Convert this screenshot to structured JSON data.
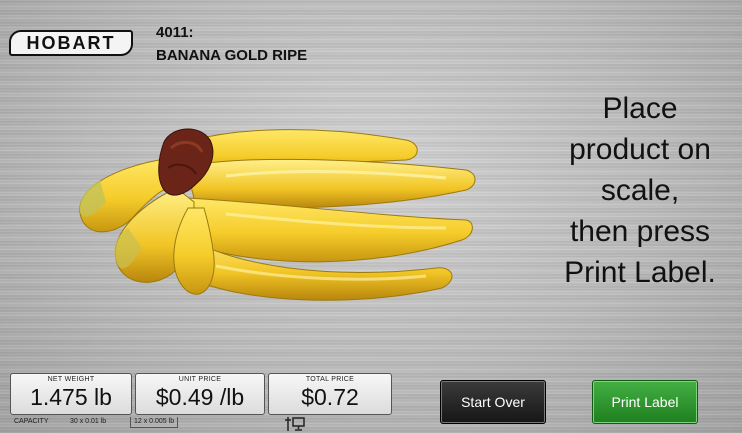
{
  "brand": {
    "logo_text": "HOBART"
  },
  "product": {
    "code": "4011:",
    "name": "BANANA GOLD RIPE",
    "image": "banana-bunch"
  },
  "instructions": {
    "lines": [
      "Place",
      "product on",
      "scale,",
      "then press",
      "Print Label."
    ]
  },
  "readouts": {
    "net_weight": {
      "label": "NET WEIGHT",
      "value": "1.475 lb"
    },
    "unit_price": {
      "label": "UNIT PRICE",
      "value": "$0.49 /lb"
    },
    "total_price": {
      "label": "TOTAL PRICE",
      "value": "$0.72"
    }
  },
  "capacity": {
    "label": "CAPACITY",
    "range1": "30 x 0.01 lb",
    "range2": "12 x 0.005 lb"
  },
  "buttons": {
    "start_over": "Start Over",
    "print_label": "Print Label"
  },
  "icons": {
    "status": "network-connection-icon"
  },
  "colors": {
    "print_button": "#2e9a2e",
    "start_button": "#222222",
    "background": "#c4c4c4"
  }
}
